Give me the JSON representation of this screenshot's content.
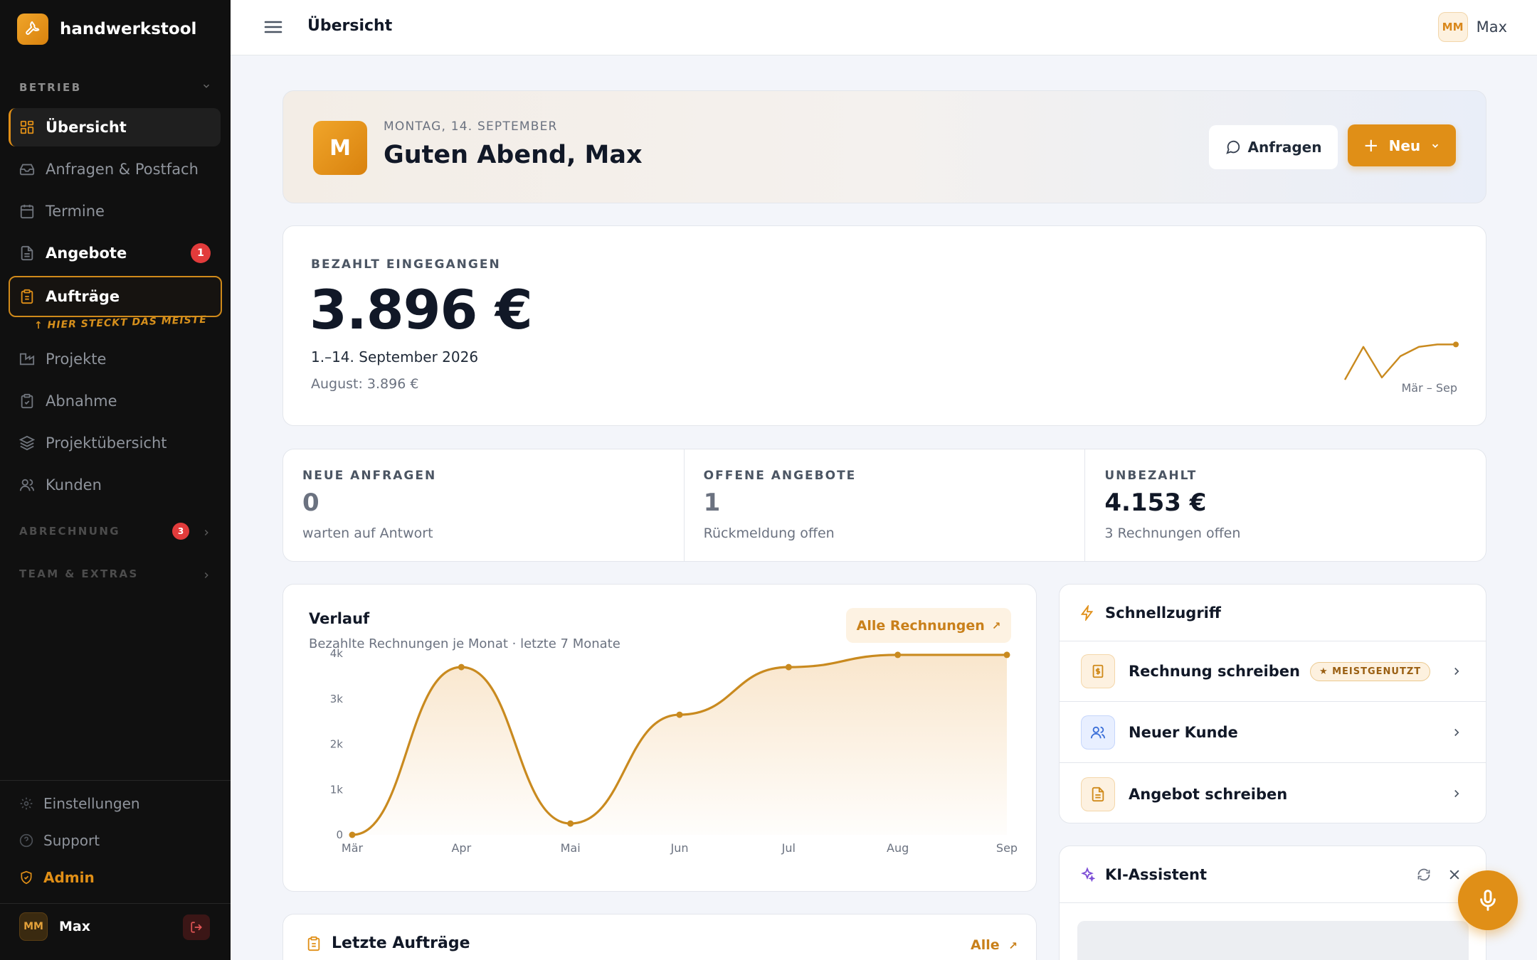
{
  "app": {
    "name": "handwerkstool"
  },
  "sidebar": {
    "section_betrieb": "BETRIEB",
    "items": [
      {
        "label": "Übersicht",
        "icon": "dashboard-icon"
      },
      {
        "label": "Anfragen & Postfach",
        "icon": "inbox-icon"
      },
      {
        "label": "Termine",
        "icon": "calendar-icon"
      },
      {
        "label": "Angebote",
        "icon": "document-icon",
        "badge": "1"
      },
      {
        "label": "Aufträge",
        "icon": "clipboard-icon"
      },
      {
        "label": "Projekte",
        "icon": "factory-icon"
      },
      {
        "label": "Abnahme",
        "icon": "clipboard-check-icon"
      },
      {
        "label": "Projektübersicht",
        "icon": "layers-icon"
      },
      {
        "label": "Kunden",
        "icon": "users-icon"
      }
    ],
    "hint": "↑ HIER STECKT DAS MEISTE",
    "section_abrechnung": "ABRECHNUNG",
    "abrechnung_badge": "3",
    "section_team": "TEAM & EXTRAS",
    "footer": {
      "settings": "Einstellungen",
      "support": "Support",
      "admin": "Admin"
    },
    "user": {
      "initials": "MM",
      "name": "Max"
    }
  },
  "topbar": {
    "title": "Übersicht",
    "user_initials": "MM",
    "user_name": "Max"
  },
  "hero": {
    "avatar": "M",
    "date": "MONTAG, 14. SEPTEMBER",
    "greeting": "Guten Abend, Max",
    "btn_anfragen": "Anfragen",
    "btn_neu": "Neu"
  },
  "paid": {
    "label": "BEZAHLT EINGEGANGEN",
    "value": "3.896 €",
    "range": "1.–14. September 2026",
    "previous": "August: 3.896 €",
    "spark_label": "Mär – Sep"
  },
  "kpis": [
    {
      "label": "NEUE ANFRAGEN",
      "value": "0",
      "sub": "warten auf Antwort"
    },
    {
      "label": "OFFENE ANGEBOTE",
      "value": "1",
      "sub": "Rückmeldung offen"
    },
    {
      "label": "UNBEZAHLT",
      "value": "4.153 €",
      "sub": "3 Rechnungen offen"
    }
  ],
  "verlauf": {
    "title": "Verlauf",
    "subtitle": "Bezahlte Rechnungen je Monat · letzte 7 Monate",
    "btn_all": "Alle Rechnungen"
  },
  "chart_data": {
    "type": "area",
    "categories": [
      "Mär",
      "Apr",
      "Mai",
      "Jun",
      "Jul",
      "Aug",
      "Sep"
    ],
    "values": [
      0,
      3700,
      250,
      2650,
      3700,
      3970,
      3970
    ],
    "yticks": [
      "0",
      "1k",
      "2k",
      "3k",
      "4k"
    ],
    "ylim": [
      0,
      4000
    ],
    "color": "#c98a1f",
    "grid": false
  },
  "quick": {
    "title": "Schnellzugriff",
    "items": [
      {
        "label": "Rechnung schreiben",
        "badge": "★ MEISTGENUTZT"
      },
      {
        "label": "Neuer Kunde"
      },
      {
        "label": "Angebot schreiben"
      }
    ]
  },
  "ki": {
    "title": "KI-Assistent"
  },
  "recent": {
    "title": "Letzte Aufträge",
    "all": "Alle"
  },
  "colors": {
    "accent": "#e08f17",
    "sidebar_bg": "#101010",
    "badge_red": "#e23b3b"
  }
}
